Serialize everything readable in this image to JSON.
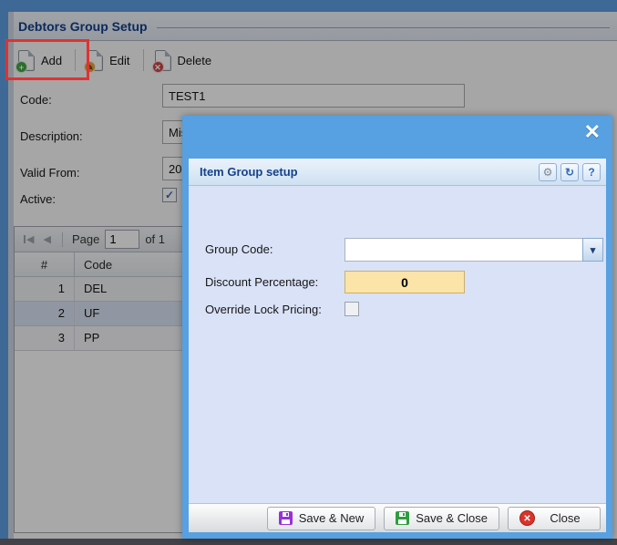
{
  "window": {
    "title": "Debtors Group Setup"
  },
  "toolbar": {
    "add_label": "Add",
    "edit_label": "Edit",
    "delete_label": "Delete",
    "add_badge": "+",
    "edit_badge": "✎",
    "delete_badge": "✕"
  },
  "form": {
    "code_label": "Code:",
    "code_value": "TEST1",
    "description_label": "Description:",
    "description_value": "Mis",
    "valid_from_label": "Valid From:",
    "valid_from_value": "20",
    "active_label": "Active:",
    "active_check": "✓"
  },
  "pager": {
    "first_glyph": "◀",
    "prev_glyph": "◀",
    "page_label": "Page",
    "page_value": "1",
    "of_label": "of 1"
  },
  "grid": {
    "col_num": "#",
    "col_code": "Code",
    "rows": [
      {
        "n": "1",
        "c": "DEL"
      },
      {
        "n": "2",
        "c": "UF"
      },
      {
        "n": "3",
        "c": "PP"
      }
    ],
    "selected_row": "UF"
  },
  "modal": {
    "title": "Item Group setup",
    "close_glyph": "✕",
    "gear_glyph": "⚙",
    "refresh_glyph": "↻",
    "help_glyph": "?",
    "group_code_label": "Group Code:",
    "group_code_value": "",
    "combo_chevron": "▾",
    "discount_label": "Discount Percentage:",
    "discount_value": "0",
    "override_label": "Override Lock Pricing:",
    "save_new_label": "Save & New",
    "save_close_label": "Save & Close",
    "close_label": "Close",
    "close_icon_glyph": "✕"
  },
  "colors": {
    "modal_frame_blue": "#57a0e2",
    "modal_body": "#d9e2f6",
    "discount_bg": "#fce3a7",
    "annotation_red": "#e03232",
    "selected_row": "#dbe4f5",
    "accent_navy": "#15428b",
    "save_new_icon": "#9b30d9",
    "save_close_icon": "#2e9e3f",
    "close_icon": "#d9352b"
  }
}
